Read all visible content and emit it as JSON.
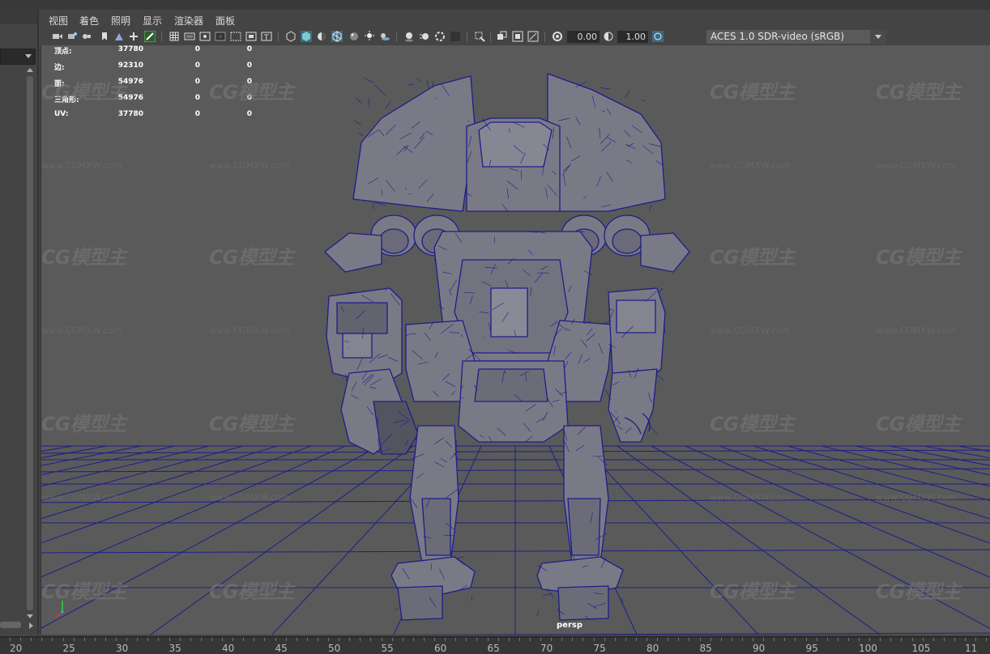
{
  "menu": [
    "视图",
    "着色",
    "照明",
    "显示",
    "渲染器",
    "面板"
  ],
  "toolbar": {
    "exposure_value": "0.00",
    "gamma_value": "1.00",
    "color_space": "ACES 1.0 SDR-video (sRGB)"
  },
  "hud": {
    "rows": [
      {
        "label": "顶点:",
        "v1": "37780",
        "v2": "0",
        "v3": "0"
      },
      {
        "label": "边:",
        "v1": "92310",
        "v2": "0",
        "v3": "0"
      },
      {
        "label": "面:",
        "v1": "54976",
        "v2": "0",
        "v3": "0"
      },
      {
        "label": "三角形:",
        "v1": "54976",
        "v2": "0",
        "v3": "0"
      },
      {
        "label": "UV:",
        "v1": "37780",
        "v2": "0",
        "v3": "0"
      }
    ]
  },
  "camera_label": "persp",
  "watermark": {
    "logo_text": "CG模型主",
    "url_text": "www.CGMXW.com"
  },
  "timeline": {
    "ticks": [
      "20",
      "25",
      "30",
      "35",
      "40",
      "45",
      "50",
      "55",
      "60",
      "65",
      "70",
      "75",
      "80",
      "85",
      "90",
      "95",
      "100",
      "105",
      "11"
    ]
  },
  "colors": {
    "wireframe": "#1d1d8c",
    "mesh_fill": "#7a7a86",
    "viewport_bg": "#5a5a5a"
  }
}
